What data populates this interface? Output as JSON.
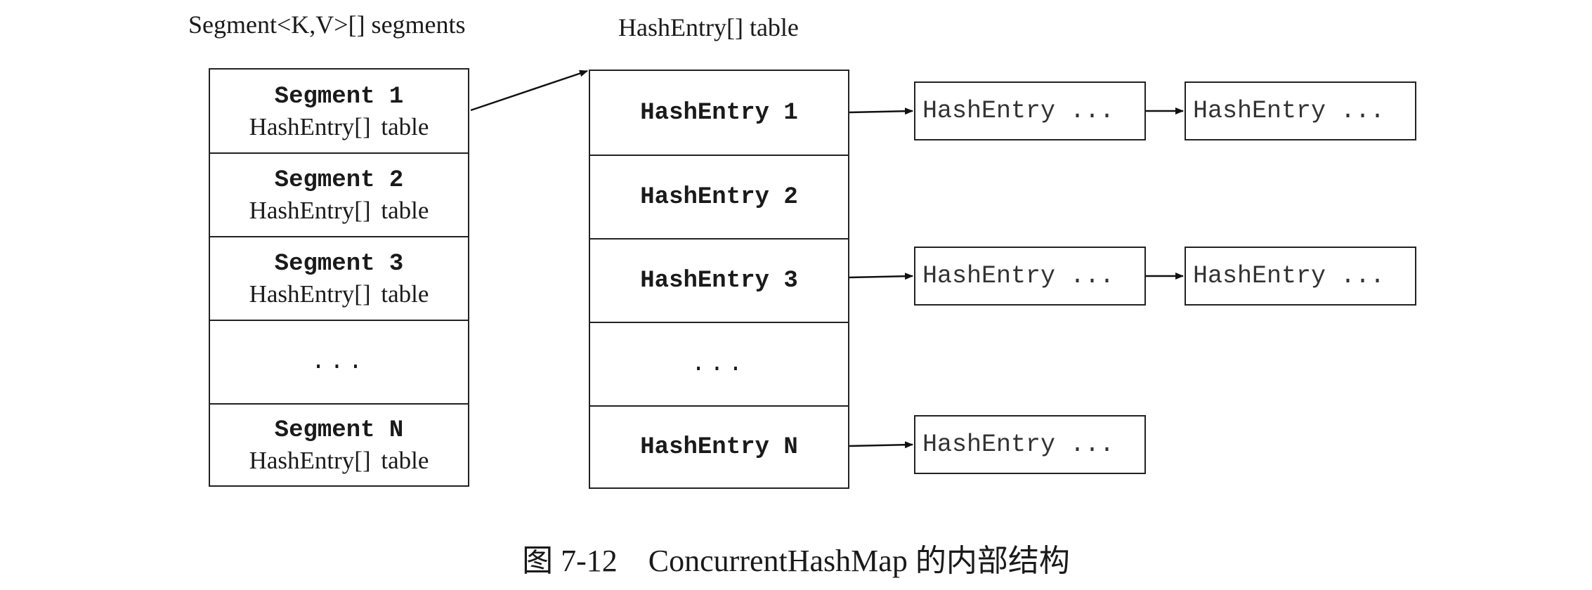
{
  "segments_label": "Segment<K,V>[] segments",
  "table_label": "HashEntry[]  table",
  "segments": [
    {
      "title": "Segment 1",
      "sub": "HashEntry[]  table"
    },
    {
      "title": "Segment 2",
      "sub": "HashEntry[]  table"
    },
    {
      "title": "Segment 3",
      "sub": "HashEntry[]  table"
    },
    {
      "title": "...",
      "sub": ""
    },
    {
      "title": "Segment N",
      "sub": "HashEntry[]  table"
    }
  ],
  "entries": [
    {
      "title": "HashEntry 1"
    },
    {
      "title": "HashEntry 2"
    },
    {
      "title": "HashEntry 3"
    },
    {
      "title": "..."
    },
    {
      "title": "HashEntry N"
    }
  ],
  "chain_nodes": {
    "row1_a": "HashEntry ...",
    "row1_b": "HashEntry ...",
    "row3_a": "HashEntry ...",
    "row3_b": "HashEntry ...",
    "rowN_a": "HashEntry ..."
  },
  "caption": "图 7-12    ConcurrentHashMap 的内部结构"
}
